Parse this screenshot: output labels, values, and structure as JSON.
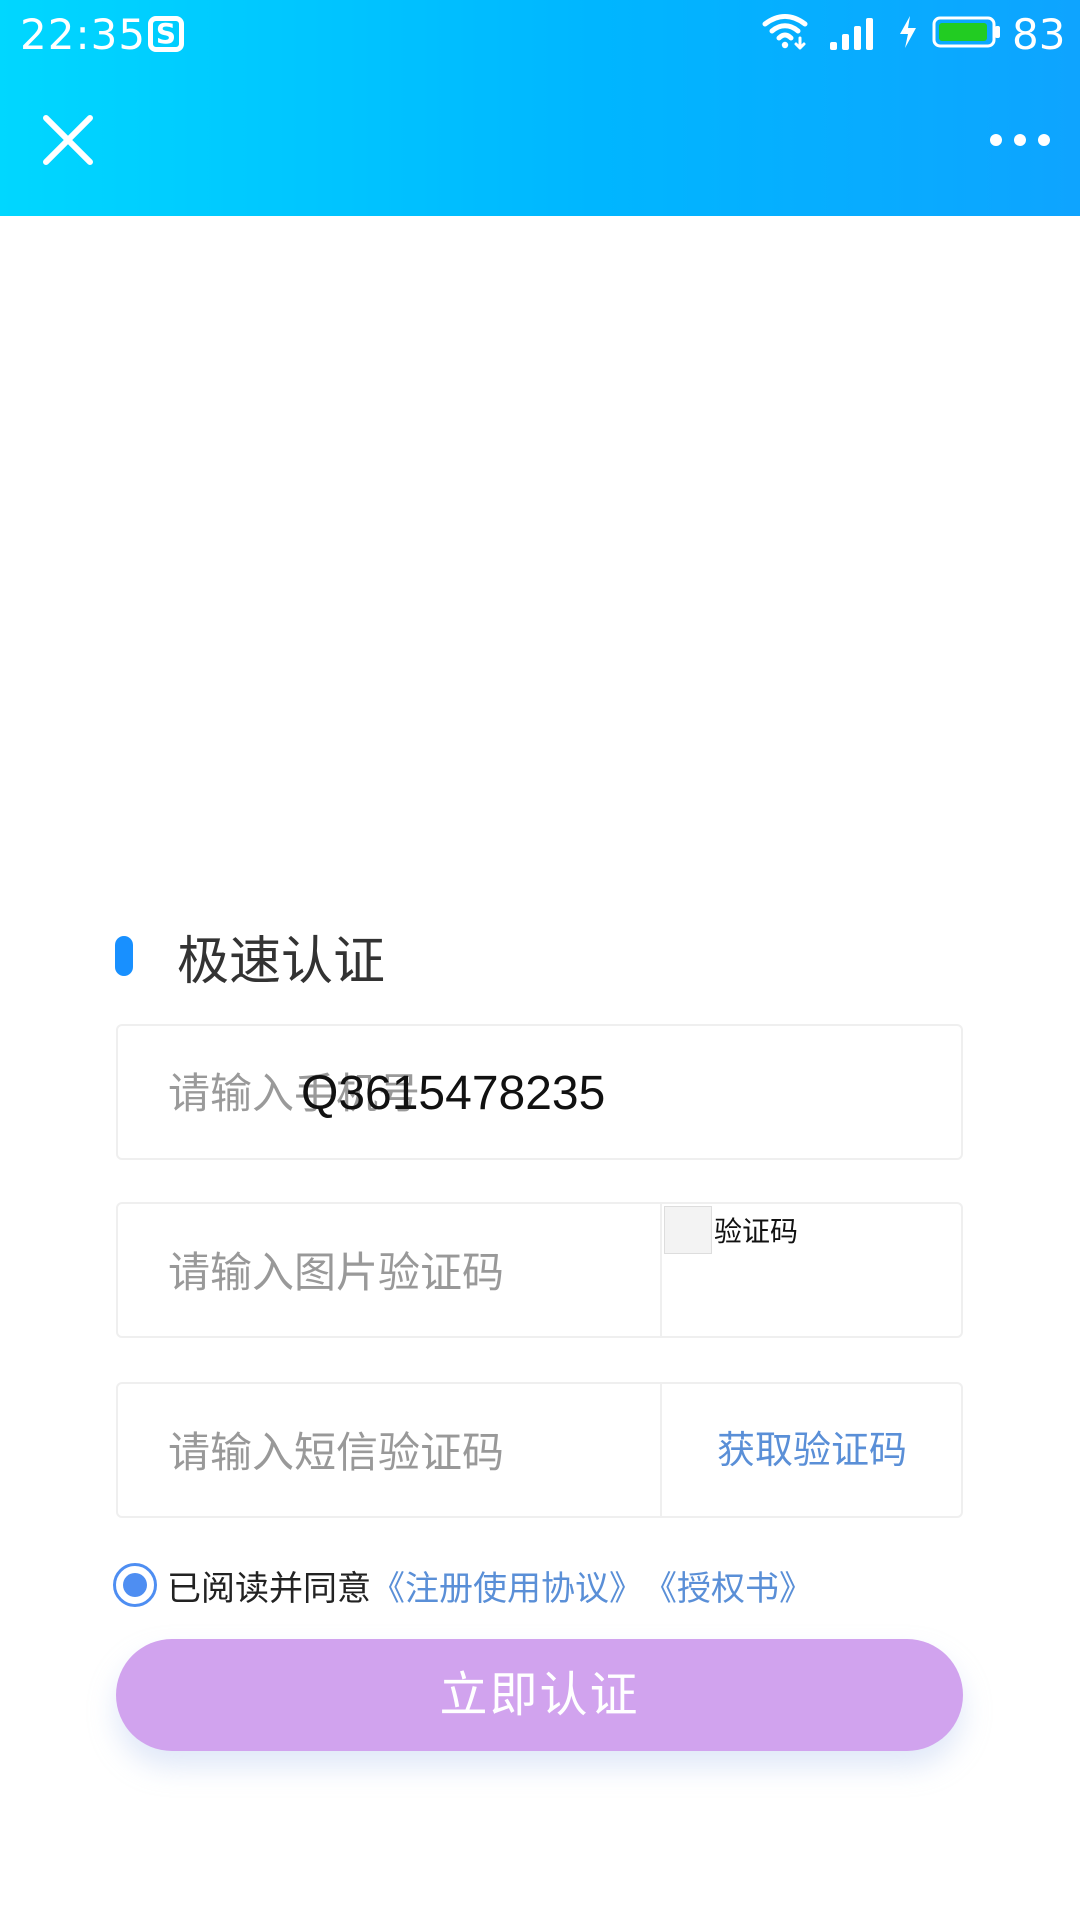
{
  "status_bar": {
    "time": "22:35",
    "app_badge": "S",
    "battery_level": "83"
  },
  "toolbar": {
    "close_icon": "close-icon",
    "more_icon": "more-icon"
  },
  "form": {
    "section_title": "极速认证",
    "phone": {
      "placeholder": "请输入手机号",
      "value": "Q3615478235"
    },
    "captcha": {
      "placeholder": "请输入图片验证码",
      "image_alt": "验证码"
    },
    "sms": {
      "placeholder": "请输入短信验证码",
      "get_code_label": "获取验证码"
    },
    "agreement": {
      "checked": true,
      "prefix": "已阅读并同意",
      "link_user_agreement": "《注册使用协议》",
      "link_authorization": "《授权书》"
    },
    "submit_label": "立即认证"
  },
  "colors": {
    "header_gradient_start": "#00d7ff",
    "header_gradient_end": "#0ea4ff",
    "accent_blue": "#1890ff",
    "link_blue": "#5a8fd7",
    "submit_bg": "#d1a3ee"
  }
}
